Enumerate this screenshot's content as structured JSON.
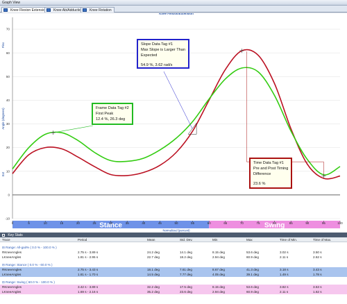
{
  "window": {
    "title": "Graph View"
  },
  "tabs": [
    {
      "label": "Knee Flexion Extension",
      "active": true
    },
    {
      "label": "Knee Ab/Adduction",
      "active": false
    },
    {
      "label": "Knee Rotation",
      "active": false
    }
  ],
  "chart_data": {
    "type": "line",
    "title": "Knee Flexion/Extension",
    "xlabel": "Normalized (percent)",
    "ylabel": "Angle (degrees)",
    "y_axis_top_label": "Flex",
    "y_axis_bottom_label": "Ext",
    "xlim": [
      0,
      100
    ],
    "ylim": [
      -10,
      75
    ],
    "x_ticks": [
      0,
      5,
      10,
      15,
      20,
      25,
      30,
      35,
      40,
      45,
      50,
      55,
      60,
      65,
      70,
      75,
      80,
      85,
      90,
      95,
      100
    ],
    "y_ticks": [
      -10,
      0,
      10,
      20,
      30,
      40,
      50,
      60,
      70
    ],
    "grid": true,
    "series": [
      {
        "name": "RKneeAngles",
        "color": "#bb1122",
        "x": [
          0,
          5,
          10,
          15,
          20,
          25,
          30,
          35,
          40,
          45,
          50,
          55,
          60,
          65,
          70,
          75,
          80,
          85,
          90,
          95,
          100
        ],
        "y": [
          9,
          17,
          20,
          19.5,
          16,
          12,
          8.6,
          8.2,
          9.5,
          12.5,
          18,
          27,
          40,
          53,
          60.9,
          59,
          47,
          28,
          13,
          7,
          8
        ]
      },
      {
        "name": "LKneeAngles",
        "color": "#33cc11",
        "x": [
          0,
          5,
          10,
          15,
          20,
          25,
          30,
          35,
          40,
          45,
          50,
          55,
          60,
          65,
          70,
          75,
          80,
          85,
          90,
          95,
          100
        ],
        "y": [
          11,
          20,
          25.6,
          26.3,
          23,
          18,
          14.5,
          14.2,
          15.5,
          19,
          24,
          31,
          40.5,
          49,
          53.6,
          52,
          42,
          27,
          15,
          8.5,
          12
        ]
      }
    ],
    "phases": [
      {
        "name": "Stance",
        "from": 0,
        "to": 60,
        "color": "#6e92e8"
      },
      {
        "name": "Swing",
        "from": 60,
        "to": 100,
        "color": "#ee8ee0"
      }
    ],
    "annotations": [
      {
        "type": "frame",
        "title": "Frame Data Tag #2",
        "lines": [
          "First Peak",
          "12.4 %, 26.3 deg"
        ],
        "x": 12.4,
        "y": 26.3
      },
      {
        "type": "slope",
        "title": "Slope Data Tag #1",
        "lines": [
          "Max Slope is Larger Than",
          "Expected",
          "",
          "54.9 %, 3.62 rad/s"
        ],
        "x": 54.9,
        "y": 28
      },
      {
        "type": "time",
        "title": "Time Data Tag #1",
        "lines": [
          "Pre and Post Timing",
          "Difference",
          "",
          "23.6 %"
        ],
        "x1": 71.5,
        "x2": 95,
        "y": 14
      }
    ]
  },
  "key_stats": {
    "title": "Key Stats",
    "columns": [
      "Trace",
      "Period",
      "Mean",
      "Std. Dev.",
      "Min",
      "Max",
      "Time of Min.",
      "Time of Max."
    ],
    "groups": [
      {
        "label": "Range: All-gait% ( 0.0 % - 100.0 % )",
        "style": "plain",
        "rows": [
          [
            "RKneeAngles",
            "2.75 s - 3.89 s",
            "24.2 deg",
            "14.1 deg",
            "8.15 deg",
            "53.6 deg",
            "3.02 s",
            "3.50 s"
          ],
          [
            "LKneeAngles",
            "1.81 s - 2.95 s",
            "22.7 deg",
            "18.2 deg",
            "2.94 deg",
            "60.9 deg",
            "2.11 s",
            "2.62 s"
          ]
        ]
      },
      {
        "label": "Range: Stance ( 0.0 % - 60.0 % )",
        "style": "blue",
        "rows": [
          [
            "RKneeAngles",
            "2.75 s - 3.43 s",
            "18.1 deg",
            "7.61 deg",
            "8.67 deg",
            "41.3 deg",
            "3.18 s",
            "3.43 s"
          ],
          [
            "LKneeAngles",
            "1.81 s - 1.70 s",
            "14.5 deg",
            "7.77 deg",
            "4.05 deg",
            "39.1 deg",
            "1.49 s",
            "1.78 s"
          ]
        ]
      },
      {
        "label": "Range: Swing ( 60.0 % - 100.0 % )",
        "style": "pink",
        "rows": [
          [
            "RKneeAngles",
            "3.42 s - 3.89 s",
            "32.2 deg",
            "17.5 deg",
            "8.15 deg",
            "53.6 deg",
            "3.82 s",
            "3.53 s"
          ],
          [
            "LKneeAngles",
            "1.69 s - 2.16 s",
            "35.2 deg",
            "23.6 deg",
            "2.94 deg",
            "60.9 deg",
            "2.11 s",
            "1.62 s"
          ]
        ]
      }
    ]
  }
}
